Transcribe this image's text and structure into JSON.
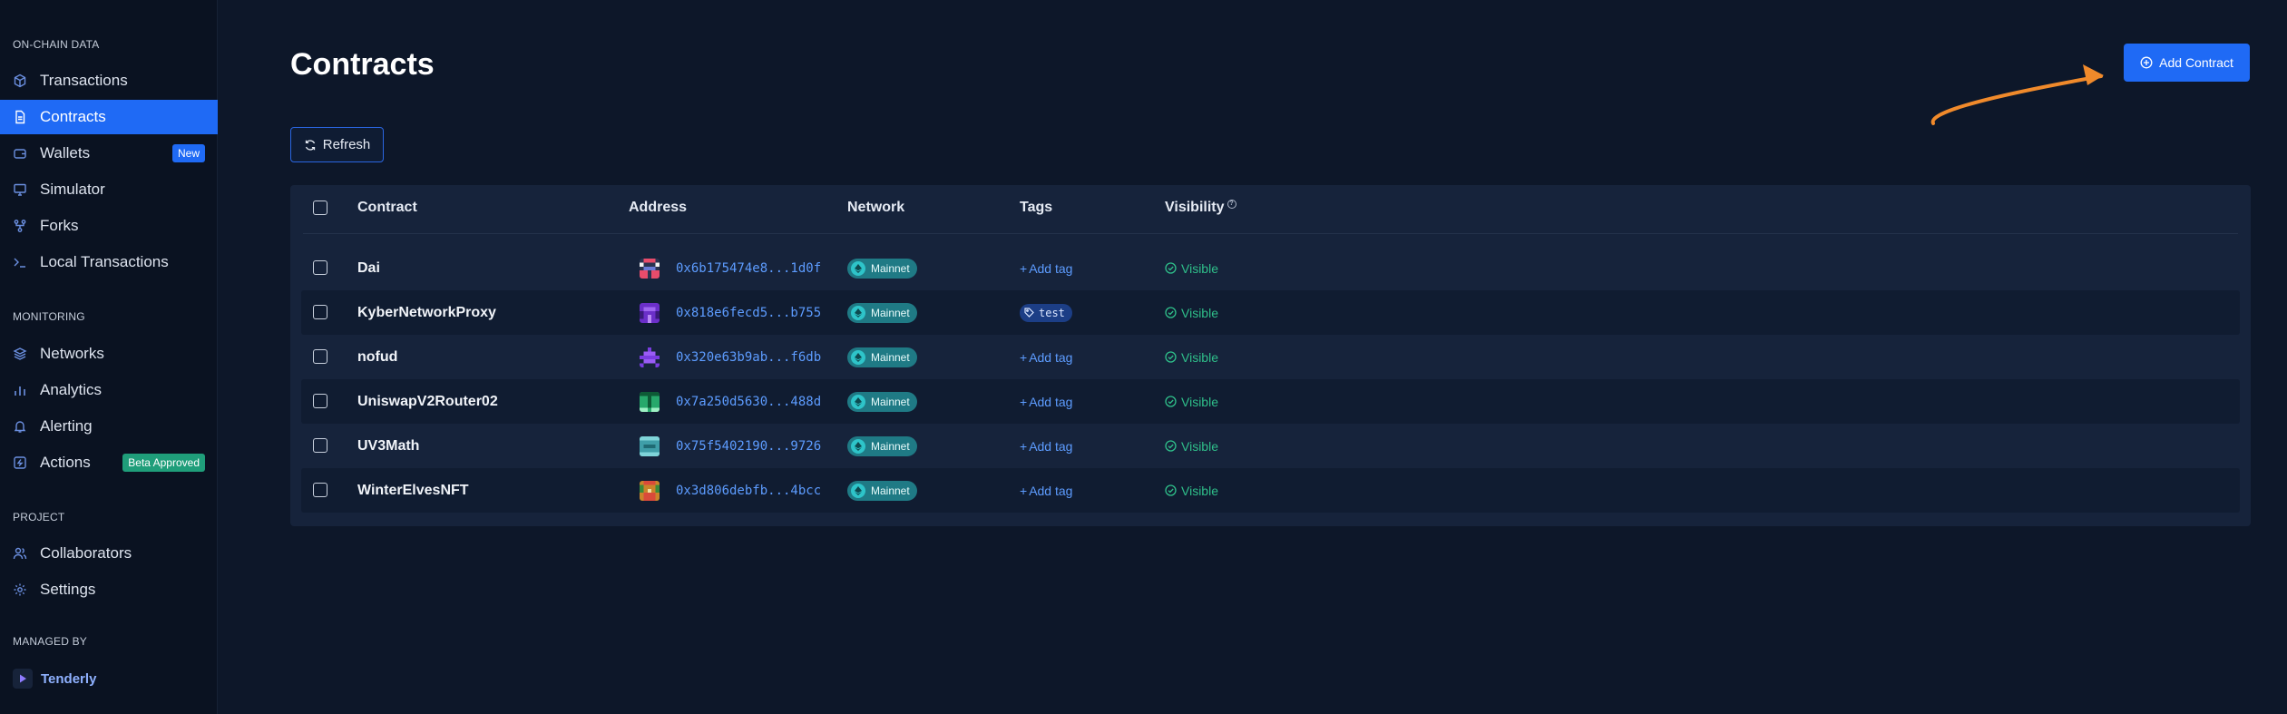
{
  "sidebar": {
    "sections": [
      {
        "label": "ON-CHAIN DATA"
      },
      {
        "label": "MONITORING"
      },
      {
        "label": "PROJECT"
      },
      {
        "label": "MANAGED BY"
      }
    ],
    "items": [
      {
        "label": "Transactions",
        "icon": "cube-icon"
      },
      {
        "label": "Contracts",
        "icon": "document-icon",
        "active": true
      },
      {
        "label": "Wallets",
        "icon": "wallet-icon",
        "badge": "New"
      },
      {
        "label": "Simulator",
        "icon": "monitor-icon"
      },
      {
        "label": "Forks",
        "icon": "fork-icon"
      },
      {
        "label": "Local Transactions",
        "icon": "terminal-icon"
      },
      {
        "label": "Networks",
        "icon": "layers-icon"
      },
      {
        "label": "Analytics",
        "icon": "bar-chart-icon"
      },
      {
        "label": "Alerting",
        "icon": "bell-icon"
      },
      {
        "label": "Actions",
        "icon": "action-icon",
        "badge": "Beta Approved"
      },
      {
        "label": "Collaborators",
        "icon": "users-icon"
      },
      {
        "label": "Settings",
        "icon": "gear-icon"
      }
    ],
    "brand": "Tenderly"
  },
  "header": {
    "title": "Contracts",
    "add_contract_label": "Add Contract",
    "refresh_label": "Refresh"
  },
  "table": {
    "columns": [
      "Contract",
      "Address",
      "Network",
      "Tags",
      "Visibility"
    ],
    "add_tag_label": "Add tag",
    "rows": [
      {
        "name": "Dai",
        "address": "0x6b175474e8...1d0f",
        "network": "Mainnet",
        "tag": null,
        "visibility": "Visible"
      },
      {
        "name": "KyberNetworkProxy",
        "address": "0x818e6fecd5...b755",
        "network": "Mainnet",
        "tag": "test",
        "visibility": "Visible"
      },
      {
        "name": "nofud",
        "address": "0x320e63b9ab...f6db",
        "network": "Mainnet",
        "tag": null,
        "visibility": "Visible"
      },
      {
        "name": "UniswapV2Router02",
        "address": "0x7a250d5630...488d",
        "network": "Mainnet",
        "tag": null,
        "visibility": "Visible"
      },
      {
        "name": "UV3Math",
        "address": "0x75f5402190...9726",
        "network": "Mainnet",
        "tag": null,
        "visibility": "Visible"
      },
      {
        "name": "WinterElvesNFT",
        "address": "0x3d806debfb...4bcc",
        "network": "Mainnet",
        "tag": null,
        "visibility": "Visible"
      }
    ]
  },
  "colors": {
    "accent": "#1f6af5",
    "background": "#0d1729",
    "link": "#5d9cff",
    "visible": "#2fbf8a",
    "annotation_arrow": "#f08a2b"
  }
}
